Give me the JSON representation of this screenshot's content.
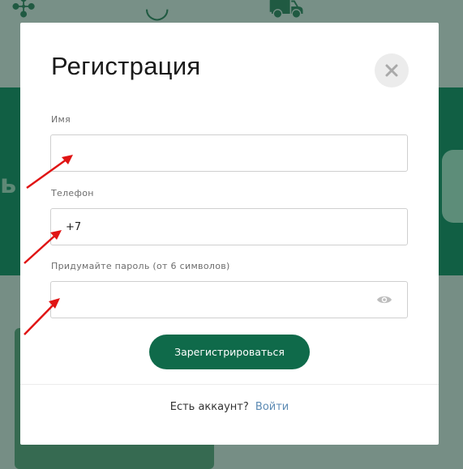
{
  "background": {
    "partial_letter": "ь"
  },
  "modal": {
    "title": "Регистрация",
    "close_icon": "close-icon"
  },
  "form": {
    "name": {
      "label": "Имя",
      "value": ""
    },
    "phone": {
      "label": "Телефон",
      "value": "+7"
    },
    "password": {
      "label": "Придумайте пароль (от 6 символов)",
      "value": "",
      "toggle_icon": "eye-icon"
    },
    "submit_label": "Зарегистрироваться"
  },
  "footer": {
    "prompt": "Есть аккаунт?",
    "login_link": "Войти"
  },
  "colors": {
    "primary_button": "#0f6a4a",
    "link": "#5b8ab3",
    "annotation_arrow": "#e01414"
  }
}
